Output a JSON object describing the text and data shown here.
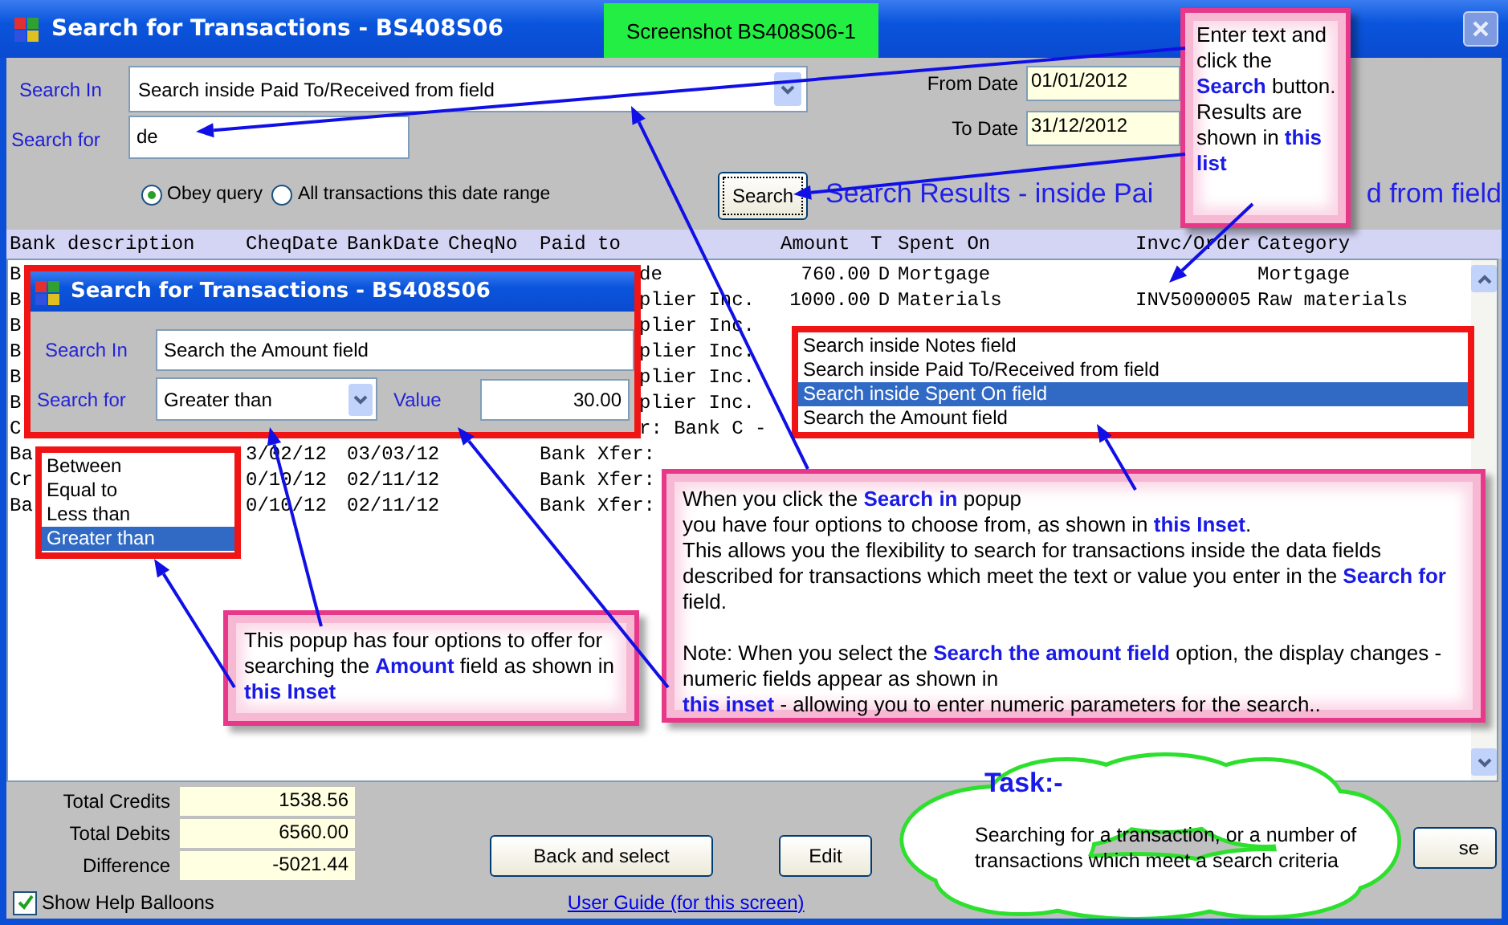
{
  "window": {
    "title": "Search for Transactions - BS408S06"
  },
  "screenshot_label": "Screenshot BS408S06-1",
  "search_form": {
    "search_in_label": "Search In",
    "search_in_value": "Search inside Paid To/Received from field",
    "search_for_label": "Search for",
    "search_for_value": "de",
    "from_date_label": "From Date",
    "from_date_value": "01/01/2012",
    "to_date_label": "To Date",
    "to_date_value": "31/12/2012",
    "radios": [
      {
        "label": "Obey query",
        "selected": true
      },
      {
        "label": "All transactions this date range",
        "selected": false
      }
    ],
    "search_button": "Search",
    "results_heading": [
      "Search Results - inside Pai",
      "d from field"
    ]
  },
  "table": {
    "columns": [
      "Bank description",
      "CheqDate",
      "BankDate",
      "CheqNo",
      "Paid to",
      "Amount",
      "T",
      "Spent On",
      "Invc/Order",
      "Category"
    ],
    "rows": [
      {
        "cells": [
          "B",
          null,
          null,
          null,
          "de",
          "760.00",
          "D",
          "Mortgage",
          null,
          "Mortgage"
        ]
      },
      {
        "cells": [
          "B",
          null,
          null,
          null,
          "plier Inc.",
          "1000.00",
          "D",
          "Materials",
          "INV5000005",
          "Raw materials"
        ]
      },
      {
        "cells": [
          "B",
          null,
          null,
          null,
          "plier Inc.",
          null,
          null,
          null,
          null,
          null
        ]
      },
      {
        "cells": [
          "B",
          null,
          null,
          null,
          "plier Inc.",
          null,
          null,
          null,
          null,
          null
        ]
      },
      {
        "cells": [
          "B",
          null,
          null,
          null,
          "plier Inc.",
          null,
          null,
          null,
          null,
          null
        ]
      },
      {
        "cells": [
          "B",
          null,
          null,
          null,
          "plier Inc.",
          null,
          null,
          null,
          null,
          null
        ]
      },
      {
        "cells": [
          "C",
          null,
          null,
          null,
          "r: Bank C -",
          null,
          null,
          null,
          null,
          null
        ]
      },
      {
        "cells": [
          "Ba",
          "3/02/12",
          "03/03/12",
          null,
          "Bank Xfer:",
          null,
          null,
          null,
          null,
          null
        ]
      },
      {
        "cells": [
          "Cr",
          "0/10/12",
          "02/11/12",
          null,
          "Bank Xfer:",
          null,
          null,
          null,
          null,
          null
        ]
      },
      {
        "cells": [
          "Ba",
          "0/10/12",
          "02/11/12",
          null,
          "Bank Xfer:",
          null,
          null,
          null,
          null,
          null
        ]
      }
    ]
  },
  "totals": [
    {
      "label": "Total Credits",
      "value": "1538.56"
    },
    {
      "label": "Total Debits",
      "value": "6560.00"
    },
    {
      "label": "Difference",
      "value": "-5021.44"
    }
  ],
  "buttons": [
    "Back and select",
    "Edit",
    "se"
  ],
  "show_help_balloons": {
    "label": "Show Help Balloons",
    "checked": true
  },
  "user_guide_link": "User Guide (for this screen)",
  "inset_dialog": {
    "title": "Search for Transactions - BS408S06",
    "search_in_label": "Search In",
    "search_in_value": "Search the Amount field",
    "search_for_label": "Search for",
    "search_for_value": "Greater than",
    "value_label": "Value",
    "value": "30.00"
  },
  "comparison_list": [
    {
      "label": "Between",
      "selected": false
    },
    {
      "label": "Equal to",
      "selected": false
    },
    {
      "label": "Less than",
      "selected": false
    },
    {
      "label": "Greater than",
      "selected": true
    }
  ],
  "search_in_list": [
    {
      "label": "Search inside Notes field",
      "selected": false
    },
    {
      "label": "Search inside Paid To/Received from field",
      "selected": false
    },
    {
      "label": "Search inside Spent On field",
      "selected": true
    },
    {
      "label": "Search the Amount field",
      "selected": false
    }
  ],
  "callouts": [
    {
      "paragraphs": [
        [
          "Enter text and click the **Search** button. Results are shown in **this list**"
        ]
      ]
    },
    {
      "paragraphs": [
        [
          "This popup has four options to offer for searching the **Amount** field as shown in **this Inset**"
        ]
      ]
    },
    {
      "paragraphs": [
        [
          "When you click the **Search in** popup",
          "you have four options to choose from, as shown in **this Inset**.",
          "This allows you the flexibility to search for transactions inside the data fields described for transactions which meet the text or value you enter in the **Search for** field."
        ],
        [
          "Note: When you select the **Search the amount field** option, the display changes - numeric fields appear as shown in",
          "**this inset** - allowing you to enter numeric parameters for the search.."
        ]
      ]
    }
  ],
  "task_cloud": {
    "title": "Task:-",
    "text": "Searching for a transaction, or a number of transactions which meet a search criteria"
  }
}
